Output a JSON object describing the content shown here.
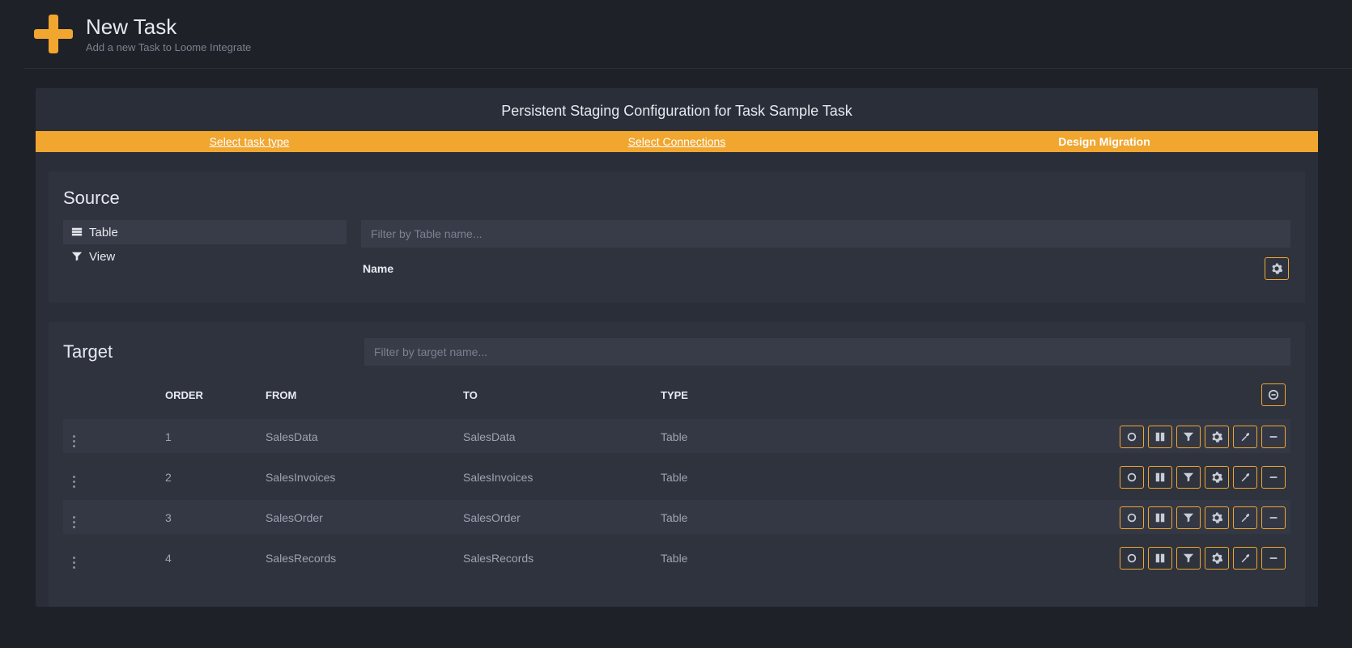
{
  "header": {
    "title": "New Task",
    "subtitle": "Add a new Task to Loome Integrate"
  },
  "panel": {
    "title": "Persistent Staging Configuration for Task Sample Task",
    "wizard": [
      {
        "label": "Select task type",
        "link": true
      },
      {
        "label": "Select Connections",
        "link": true
      },
      {
        "label": "Design Migration",
        "active": true
      }
    ]
  },
  "source": {
    "title": "Source",
    "menu": {
      "table": "Table",
      "view": "View"
    },
    "filter_placeholder": "Filter by Table name...",
    "name_column": "Name"
  },
  "target": {
    "title": "Target",
    "filter_placeholder": "Filter by target name...",
    "columns": {
      "order": "ORDER",
      "from": "FROM",
      "to": "TO",
      "type": "TYPE"
    },
    "rows": [
      {
        "order": "1",
        "from": "SalesData",
        "to": "SalesData",
        "type": "Table"
      },
      {
        "order": "2",
        "from": "SalesInvoices",
        "to": "SalesInvoices",
        "type": "Table"
      },
      {
        "order": "3",
        "from": "SalesOrder",
        "to": "SalesOrder",
        "type": "Table"
      },
      {
        "order": "4",
        "from": "SalesRecords",
        "to": "SalesRecords",
        "type": "Table"
      }
    ]
  },
  "colors": {
    "accent": "#f0a62f",
    "background": "#1e2128",
    "panel": "#2a2e38",
    "card": "#2f333e"
  }
}
